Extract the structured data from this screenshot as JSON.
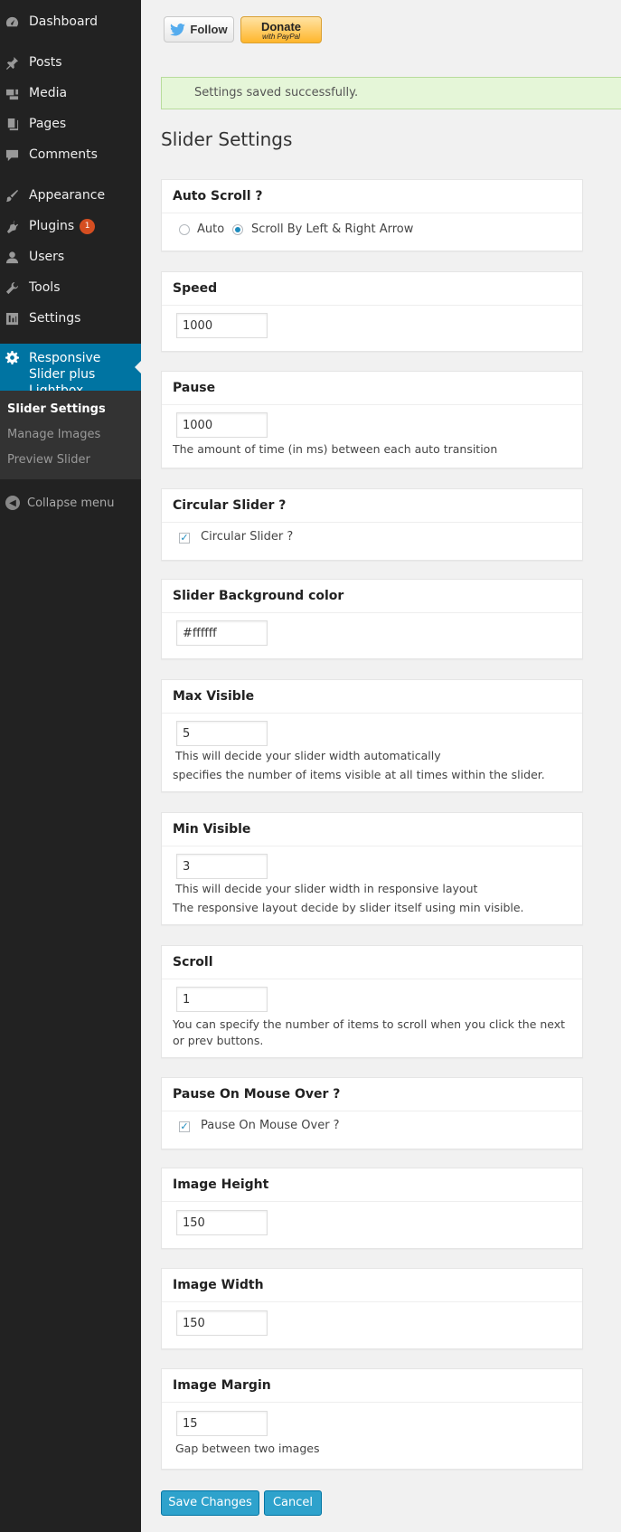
{
  "sidebar": {
    "items": [
      {
        "label": "Dashboard",
        "icon": "dashboard-icon"
      },
      {
        "label": "Posts",
        "icon": "pin-icon"
      },
      {
        "label": "Media",
        "icon": "media-icon"
      },
      {
        "label": "Pages",
        "icon": "pages-icon"
      },
      {
        "label": "Comments",
        "icon": "comment-icon"
      },
      {
        "label": "Appearance",
        "icon": "brush-icon"
      },
      {
        "label": "Plugins",
        "icon": "plugin-icon",
        "badge": "1"
      },
      {
        "label": "Users",
        "icon": "user-icon"
      },
      {
        "label": "Tools",
        "icon": "wrench-icon"
      },
      {
        "label": "Settings",
        "icon": "settings-icon"
      }
    ],
    "active": {
      "label": "Responsive Slider plus Lightbox",
      "icon": "gear-icon"
    },
    "submenu": [
      "Slider Settings",
      "Manage Images",
      "Preview Slider"
    ],
    "collapse_label": "Collapse menu"
  },
  "social": {
    "follow_label": "Follow",
    "donate_label": "Donate",
    "donate_sub": "with PayPal"
  },
  "notice": "Settings saved successfully.",
  "page_title": "Slider Settings",
  "colors": {
    "sidebar_bg": "#222222",
    "active_bg": "#0074a2",
    "primary_button": "#2ea2cc",
    "notice_bg": "#e5f6d8"
  },
  "sections": {
    "auto_scroll": {
      "title": "Auto Scroll ?",
      "options": [
        "Auto",
        "Scroll By Left & Right Arrow"
      ],
      "selected": "Scroll By Left & Right Arrow"
    },
    "speed": {
      "title": "Speed",
      "value": "1000"
    },
    "pause": {
      "title": "Pause",
      "value": "1000",
      "help": "The amount of time (in ms) between each auto transition"
    },
    "circular": {
      "title": "Circular Slider ?",
      "checkbox_label": "Circular Slider ?",
      "checked": true
    },
    "bg_color": {
      "title": "Slider Background color",
      "value": "#ffffff"
    },
    "max_visible": {
      "title": "Max Visible",
      "value": "5",
      "help1": "This will decide your slider width automatically",
      "help2": "specifies the number of items visible at all times within the slider."
    },
    "min_visible": {
      "title": "Min Visible",
      "value": "3",
      "help1": "This will decide your slider width in responsive layout",
      "help2": "The responsive layout decide by slider itself using min visible."
    },
    "scroll": {
      "title": "Scroll",
      "value": "1",
      "help1": "You can specify the number of items to scroll when you click the next",
      "help2": "or prev buttons."
    },
    "pause_hover": {
      "title": "Pause On Mouse Over ?",
      "checkbox_label": "Pause On Mouse Over ?",
      "checked": true
    },
    "image_height": {
      "title": "Image Height",
      "value": "150"
    },
    "image_width": {
      "title": "Image Width",
      "value": "150"
    },
    "image_margin": {
      "title": "Image Margin",
      "value": "15",
      "help": "Gap between two images"
    }
  },
  "actions": {
    "save_label": "Save Changes",
    "cancel_label": "Cancel"
  }
}
